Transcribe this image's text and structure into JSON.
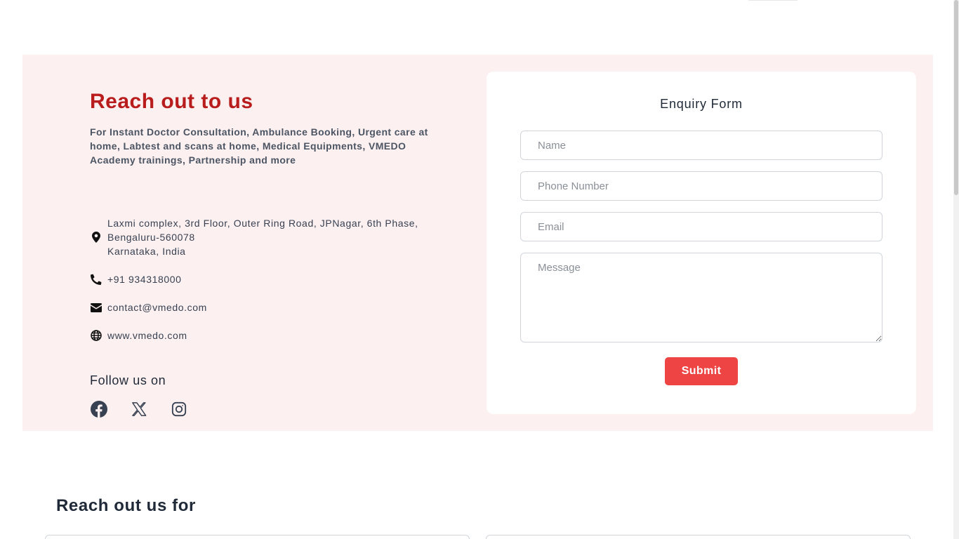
{
  "contact": {
    "title": "Reach out to us",
    "subtitle": "For Instant Doctor Consultation, Ambulance Booking, Urgent care at home, Labtest and scans at home, Medical Equipments, VMEDO Academy trainings, Partnership and more",
    "address_lines": [
      "Laxmi complex, 3rd Floor, Outer Ring Road, JPNagar, 6th Phase,",
      "Bengaluru-560078",
      "Karnataka, India"
    ],
    "phone": "+91 934318000",
    "email": "contact@vmedo.com",
    "website": "www.vmedo.com",
    "follow_label": "Follow us on",
    "social_icons": [
      "facebook-icon",
      "x-icon",
      "instagram-icon"
    ],
    "accent_color": "#b91c1c",
    "section_bg": "#fdf0f0"
  },
  "form": {
    "title": "Enquiry Form",
    "name_placeholder": "Name",
    "phone_placeholder": "Phone Number",
    "email_placeholder": "Email",
    "message_placeholder": "Message",
    "submit_label": "Submit",
    "button_color": "#ef4444"
  },
  "section2": {
    "title": "Reach out us for"
  }
}
